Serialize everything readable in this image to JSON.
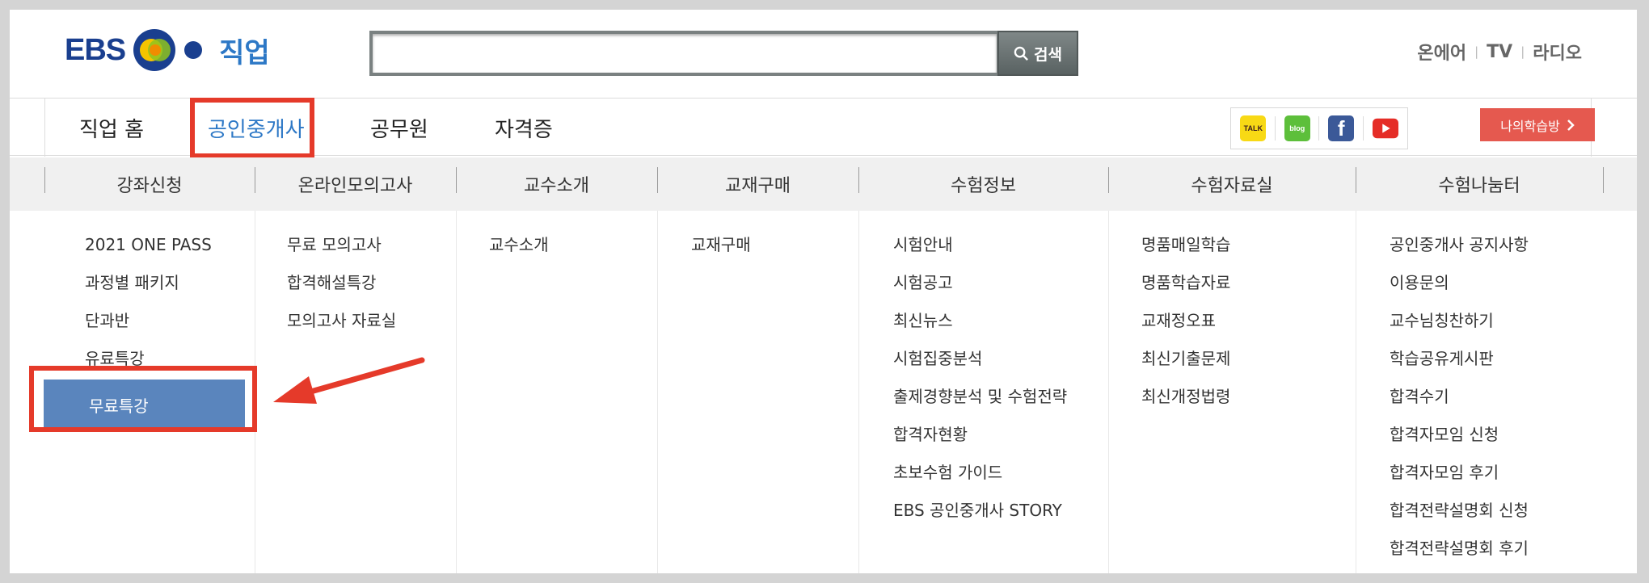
{
  "header": {
    "logo_ebs": "EBS",
    "logo_word": "직업",
    "search": {
      "value": "",
      "placeholder": "",
      "button_label": "검색"
    },
    "util_links": [
      "온에어",
      "TV",
      "라디오"
    ]
  },
  "nav": {
    "items": [
      {
        "label": "직업 홈",
        "active": false
      },
      {
        "label": "공인중개사",
        "active": true
      },
      {
        "label": "공무원",
        "active": false
      },
      {
        "label": "자격증",
        "active": false
      }
    ],
    "social": [
      {
        "name": "kakao-talk-icon",
        "text": "TALK"
      },
      {
        "name": "blog-icon",
        "text": "blog"
      },
      {
        "name": "facebook-icon",
        "text": "f"
      },
      {
        "name": "youtube-icon",
        "text": ""
      }
    ],
    "my_learning_label": "나의학습방"
  },
  "submenu": {
    "columns": [
      {
        "title": "강좌신청",
        "items": [
          "2021 ONE PASS",
          "과정별 패키지",
          "단과반",
          "유료특강"
        ],
        "highlighted": "무료특강"
      },
      {
        "title": "온라인모의고사",
        "items": [
          "무료 모의고사",
          "합격해설특강",
          "모의고사 자료실"
        ]
      },
      {
        "title": "교수소개",
        "items": [
          "교수소개"
        ]
      },
      {
        "title": "교재구매",
        "items": [
          "교재구매"
        ]
      },
      {
        "title": "수험정보",
        "items": [
          "시험안내",
          "시험공고",
          "최신뉴스",
          "시험집중분석",
          "출제경향분석 및 수험전략",
          "합격자현황",
          "초보수험 가이드",
          "EBS 공인중개사 STORY"
        ]
      },
      {
        "title": "수험자료실",
        "items": [
          "명품매일학습",
          "명품학습자료",
          "교재정오표",
          "최신기출문제",
          "최신개정법령"
        ]
      },
      {
        "title": "수험나눔터",
        "items": [
          "공인중개사 공지사항",
          "이용문의",
          "교수님칭찬하기",
          "학습공유게시판",
          "합격수기",
          "합격자모임 신청",
          "합격자모임 후기",
          "합격전략설명회 신청",
          "합격전략설명회 후기"
        ]
      }
    ]
  },
  "colors": {
    "accent_red": "#e53a2a",
    "brand_blue": "#2d78c6",
    "highlight_blue": "#5a85bd",
    "mylearn_red": "#e5594f"
  }
}
